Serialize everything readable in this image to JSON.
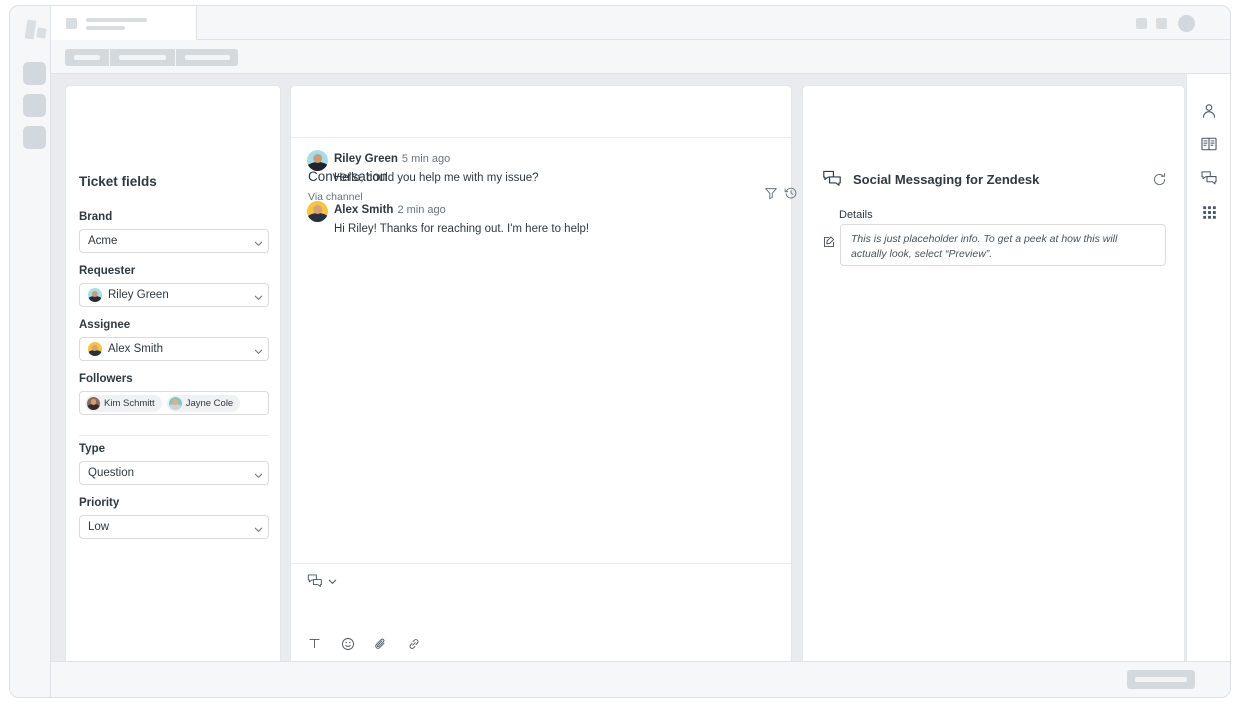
{
  "window": {
    "left_rail": {
      "logo": "zendesk-logo-skeleton",
      "items": [
        "nav-placeholder-1",
        "nav-placeholder-2",
        "nav-placeholder-3"
      ]
    },
    "top_chrome": {
      "ticket_tab": "ticket-tab-skeleton",
      "right_controls": [
        "square-placeholder-1",
        "square-placeholder-2",
        "avatar-placeholder"
      ]
    },
    "toolbar": {
      "buttons": [
        "toolbar-skeleton-1",
        "toolbar-skeleton-2",
        "toolbar-skeleton-3"
      ]
    },
    "bottom_bar": {
      "button": "submit-button-skeleton"
    }
  },
  "ticket_fields": {
    "title": "Ticket fields",
    "fields": [
      {
        "label": "Brand",
        "value": "Acme",
        "type": "select",
        "has_avatar": false
      },
      {
        "label": "Requester",
        "value": "Riley Green",
        "type": "select",
        "has_avatar": true,
        "avatar_color": "#a8dce8"
      },
      {
        "label": "Assignee",
        "value": "Alex Smith",
        "type": "select",
        "has_avatar": true,
        "avatar_color": "#f5c443"
      }
    ],
    "followers": {
      "label": "Followers",
      "items": [
        {
          "name": "Kim Schmitt",
          "avatar_color": "#8a6b5d"
        },
        {
          "name": "Jayne Cole",
          "avatar_color": "#7fc8c4"
        }
      ]
    },
    "fields_lower": [
      {
        "label": "Type",
        "value": "Question",
        "type": "select",
        "has_avatar": false
      },
      {
        "label": "Priority",
        "value": "Low",
        "type": "select",
        "has_avatar": false
      }
    ]
  },
  "conversation": {
    "title": "Conversation",
    "subtitle": "Via channel",
    "header_icons": [
      "filter-icon",
      "history-icon",
      "more-options-icon"
    ],
    "messages": [
      {
        "author": "Riley Green",
        "time": "5 min ago",
        "body": "Hello, could you help me with my issue?",
        "avatar_color": "#a8dce8"
      },
      {
        "author": "Alex Smith",
        "time": "2 min ago",
        "body": "Hi Riley! Thanks for reaching out. I'm here to help!",
        "avatar_color": "#f5c443"
      }
    ],
    "composer": {
      "channel_icon": "messaging-channel-icon",
      "channel_chevron": "chevron-down-icon",
      "tools": [
        "text-format-icon",
        "emoji-icon",
        "attachment-icon",
        "link-icon"
      ]
    }
  },
  "app_panel": {
    "icon": "social-messaging-icon",
    "title": "Social Messaging for Zendesk",
    "refresh_icon": "refresh-icon",
    "details_label": "Details",
    "edit_icon": "edit-icon",
    "details_text": "This is just placeholder info. To get a peek at how this will actually look, select “Preview”."
  },
  "right_rail": {
    "icons": [
      "user-icon",
      "knowledge-base-icon",
      "conversations-icon",
      "apps-grid-icon"
    ]
  },
  "colors": {
    "background": "#e9ebee",
    "card": "#ffffff",
    "border": "#e3e6ea",
    "text_primary": "#2f3941",
    "text_secondary": "#68737d",
    "skeleton": "#d4d9de"
  }
}
